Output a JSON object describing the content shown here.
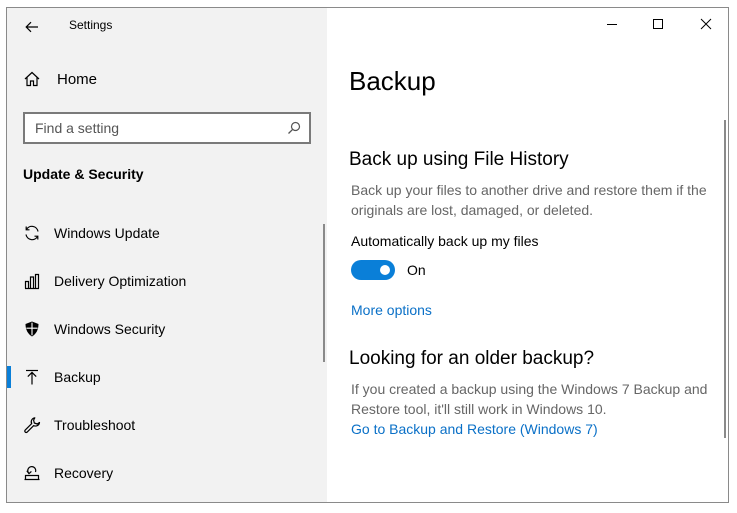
{
  "titlebar": {
    "app_title": "Settings"
  },
  "sidebar": {
    "home_label": "Home",
    "search_placeholder": "Find a setting",
    "section_title": "Update & Security",
    "items": [
      {
        "label": "Windows Update",
        "icon": "sync-icon"
      },
      {
        "label": "Delivery Optimization",
        "icon": "delivery-optimization-icon"
      },
      {
        "label": "Windows Security",
        "icon": "shield-icon"
      },
      {
        "label": "Backup",
        "icon": "backup-upload-icon",
        "selected": true
      },
      {
        "label": "Troubleshoot",
        "icon": "wrench-icon"
      },
      {
        "label": "Recovery",
        "icon": "recovery-icon"
      }
    ]
  },
  "main": {
    "title": "Backup",
    "file_history": {
      "heading": "Back up using File History",
      "description": "Back up your files to another drive and restore them if the originals are lost, damaged, or deleted.",
      "toggle_label": "Automatically back up my files",
      "toggle_state": "On",
      "more_options": "More options"
    },
    "older_backup": {
      "heading": "Looking for an older backup?",
      "description": "If you created a backup using the Windows 7 Backup and Restore tool, it'll still work in Windows 10.",
      "link": "Go to Backup and Restore (Windows 7)"
    }
  },
  "colors": {
    "accent": "#0a7fd8",
    "link": "#0a70c7",
    "sidebar_bg": "#f2f2f2"
  }
}
